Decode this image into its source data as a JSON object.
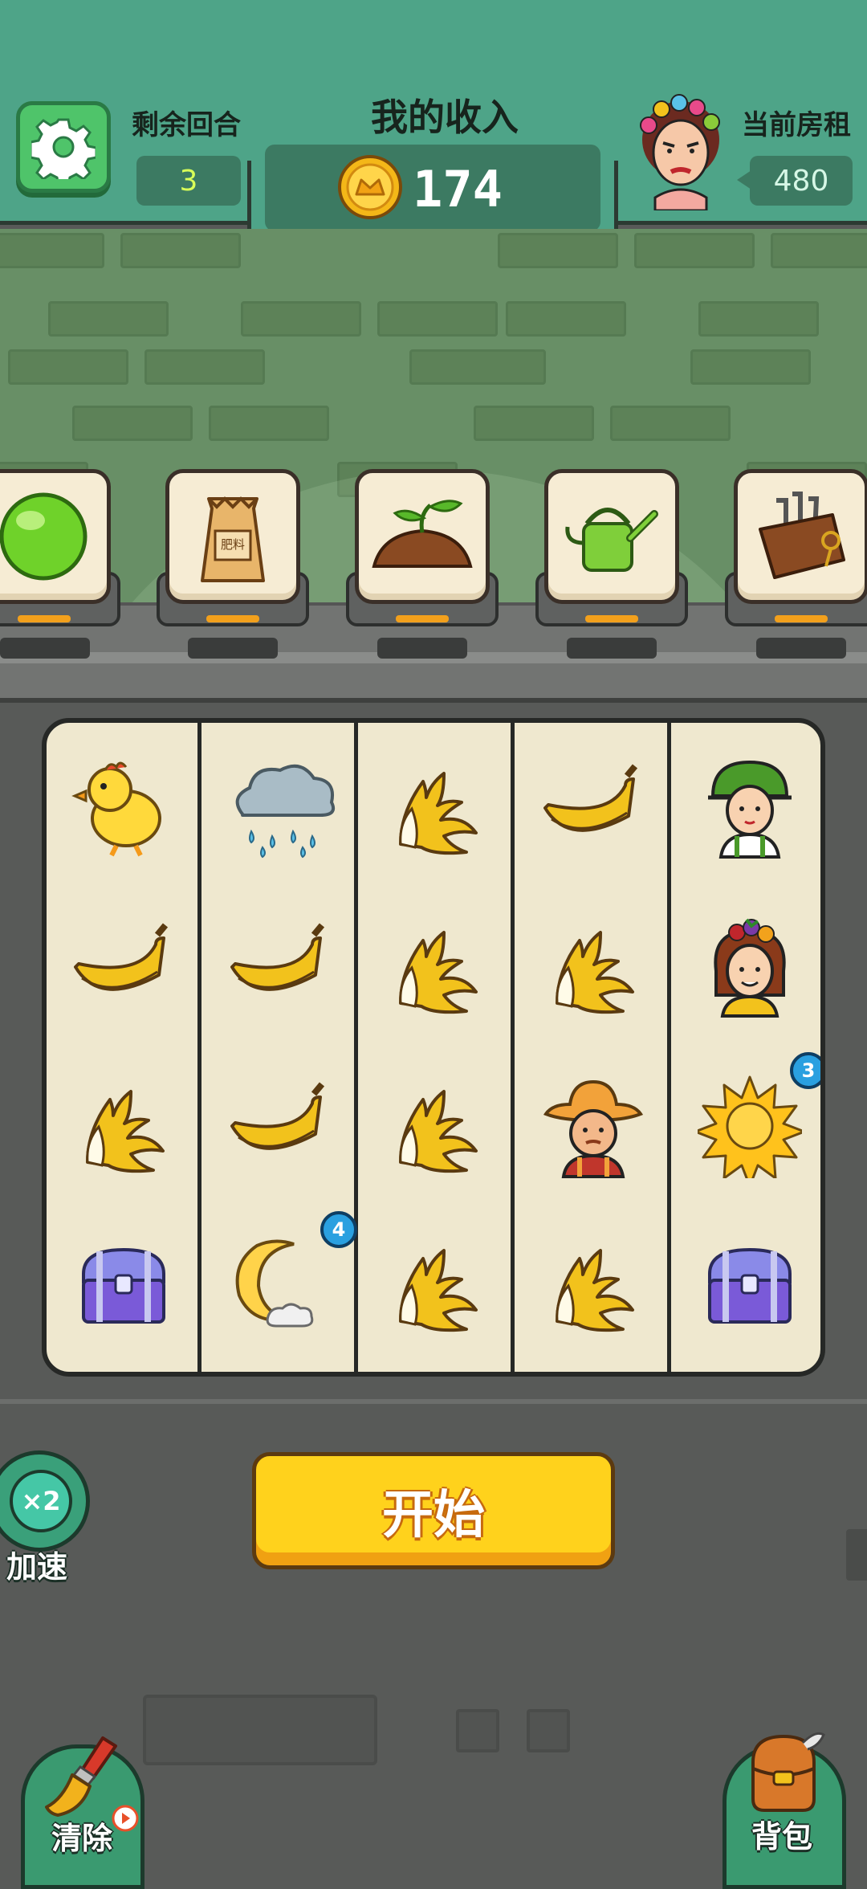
{
  "header": {
    "rounds_label": "剩余回合",
    "rounds_value": "3",
    "income_label": "我的收入",
    "income_value": "174",
    "rent_label": "当前房租",
    "rent_value": "480"
  },
  "shelf": {
    "items": [
      {
        "icon": "green-orb-icon"
      },
      {
        "icon": "fertilizer-bag-icon",
        "text": "肥料"
      },
      {
        "icon": "sprout-soil-icon"
      },
      {
        "icon": "watering-can-icon"
      },
      {
        "icon": "tool-pouch-icon"
      }
    ]
  },
  "board": {
    "rows": [
      [
        "chick",
        "rain-cloud",
        "banana-peeled",
        "banana-bunch",
        "farmer-girl"
      ],
      [
        "banana-bunch",
        "banana-bunch",
        "banana-peeled",
        "banana-peeled",
        "fruit-hat-girl"
      ],
      [
        "banana-peeled",
        "banana-bunch",
        "banana-peeled",
        "farmer-man",
        "sun"
      ],
      [
        "treasure-chest",
        "moon",
        "banana-peeled",
        "banana-peeled",
        "treasure-chest"
      ]
    ],
    "badges": {
      "sun": "3",
      "moon": "4"
    }
  },
  "controls": {
    "speed_multiplier": "×2",
    "speed_label": "加速",
    "start_label": "开始",
    "clear_label": "清除",
    "bag_label": "背包"
  },
  "colors": {
    "header": "#4ea488",
    "accent_yellow": "#ffd21c",
    "badge_blue": "#2aa0e0"
  }
}
